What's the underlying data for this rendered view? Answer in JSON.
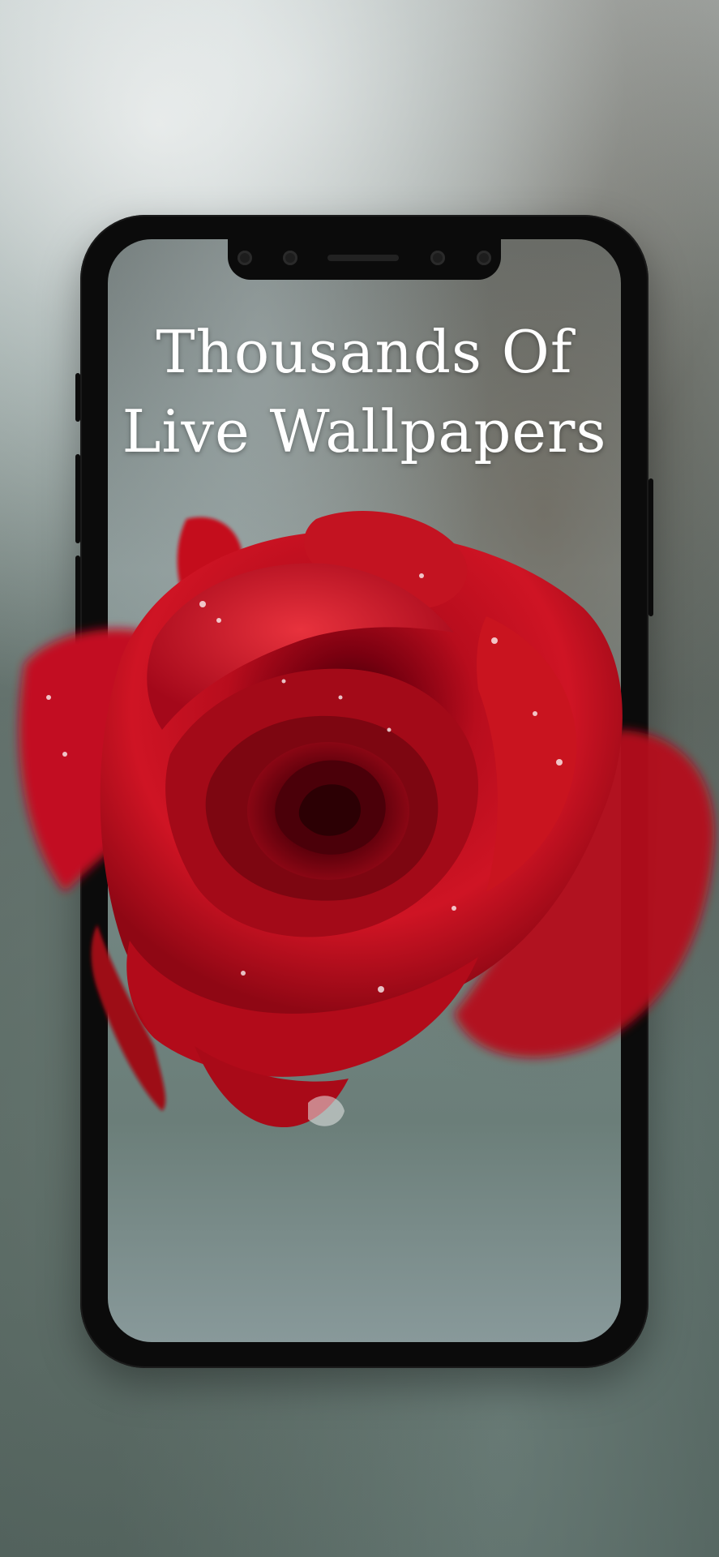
{
  "headline": {
    "line1": "Thousands Of",
    "line2": "Live Wallpapers"
  },
  "phone": {
    "notch_icons": [
      "camera-dot-icon",
      "sensor-dot-icon",
      "speaker-grille",
      "sensor-dot-icon",
      "camera-dot-icon"
    ]
  },
  "colors": {
    "rose_red": "#c40d1f",
    "rose_dark": "#6d0008",
    "phone_frame": "#0b0b0b",
    "text": "#ffffff"
  }
}
